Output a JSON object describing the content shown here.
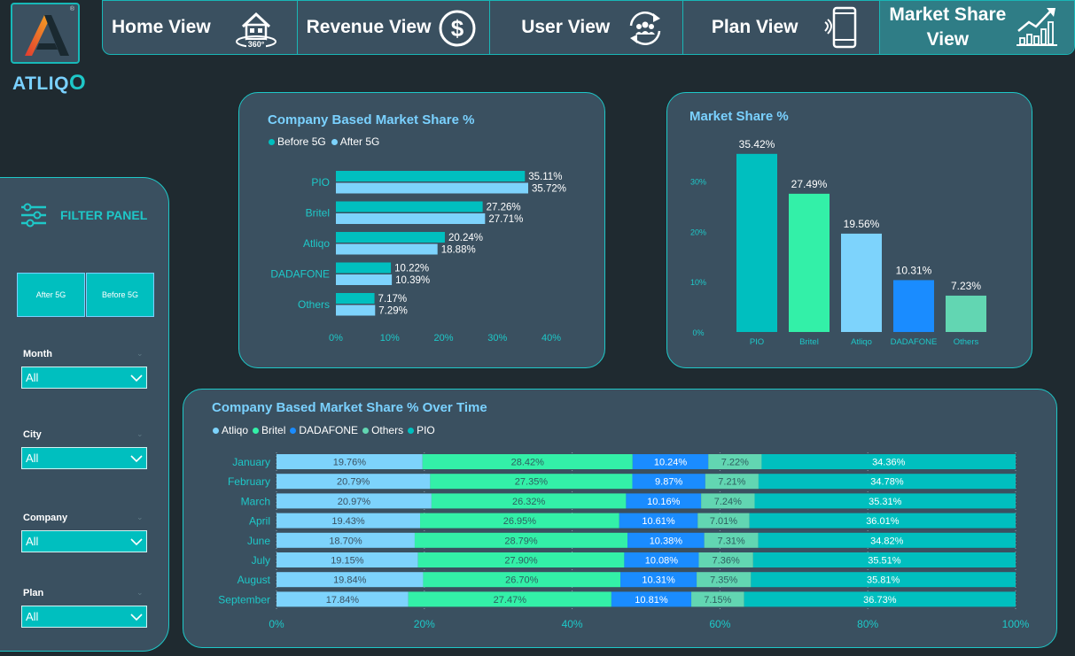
{
  "brand": {
    "name": "ATLIQ",
    "name_suffix": "O",
    "registered": "®"
  },
  "nav": [
    {
      "label": "Home View",
      "icon": "home-360-icon"
    },
    {
      "label": "Revenue View",
      "icon": "dollar-icon"
    },
    {
      "label": "User View",
      "icon": "users-icon"
    },
    {
      "label": "Plan View",
      "icon": "mobile-icon"
    },
    {
      "label_line1": "Market Share",
      "label_line2": "View",
      "icon": "growth-chart-icon",
      "active": true
    }
  ],
  "filter_panel": {
    "title": "FILTER PANEL",
    "buttons": [
      "After 5G",
      "Before 5G"
    ],
    "filters": [
      {
        "label": "Month",
        "value": "All"
      },
      {
        "label": "City",
        "value": "All"
      },
      {
        "label": "Company",
        "value": "All"
      },
      {
        "label": "Plan",
        "value": "All"
      }
    ]
  },
  "colors": {
    "accent": "#1ec8c8",
    "title": "#7ad1ff",
    "card_bg": "#3a5060",
    "page_bg": "#1f2a30",
    "atliqo": "#7dd3fc",
    "britel": "#33f0a8",
    "dadafone": "#1a8cff",
    "others": "#62d6b2",
    "pio": "#00bfbf"
  },
  "chart_data": [
    {
      "id": "company-market-share",
      "type": "bar",
      "orientation": "horizontal",
      "title": "Company Based Market Share %",
      "categories": [
        "PIO",
        "Britel",
        "Atliqo",
        "DADAFONE",
        "Others"
      ],
      "series": [
        {
          "name": "Before 5G",
          "values": [
            35.11,
            27.26,
            20.24,
            10.22,
            7.17
          ],
          "labels": [
            "35.11%",
            "27.26%",
            "20.24%",
            "10.22%",
            "7.17%"
          ],
          "color": "#00bfbf"
        },
        {
          "name": "After 5G",
          "values": [
            35.72,
            27.71,
            18.88,
            10.39,
            7.29
          ],
          "labels": [
            "35.72%",
            "27.71%",
            "18.88%",
            "10.39%",
            "7.29%"
          ],
          "color": "#7dd3fc"
        }
      ],
      "xlim": [
        0,
        40
      ],
      "xticks": [
        "0%",
        "10%",
        "20%",
        "30%",
        "40%"
      ]
    },
    {
      "id": "market-share",
      "type": "bar",
      "title": "Market Share %",
      "categories": [
        "PIO",
        "Britel",
        "Atliqo",
        "DADAFONE",
        "Others"
      ],
      "values": [
        35.42,
        27.49,
        19.56,
        10.31,
        7.23
      ],
      "labels": [
        "35.42%",
        "27.49%",
        "19.56%",
        "10.31%",
        "7.23%"
      ],
      "colors": [
        "#00bfbf",
        "#33f0a8",
        "#7dd3fc",
        "#1a8cff",
        "#62d6b2"
      ],
      "ylim": [
        0,
        36
      ],
      "yticks": [
        "0%",
        "10%",
        "20%",
        "30%"
      ]
    },
    {
      "id": "market-share-over-time",
      "type": "bar",
      "stacked": "percent",
      "orientation": "horizontal",
      "title": "Company Based Market Share % Over Time",
      "categories": [
        "January",
        "February",
        "March",
        "April",
        "June",
        "July",
        "August",
        "September"
      ],
      "series": [
        {
          "name": "Atliqo",
          "color": "#7dd3fc",
          "values": [
            19.76,
            20.79,
            20.97,
            19.43,
            18.7,
            19.15,
            19.84,
            17.84
          ],
          "labels": [
            "19.76%",
            "20.79%",
            "20.97%",
            "19.43%",
            "18.70%",
            "19.15%",
            "19.84%",
            "17.84%"
          ]
        },
        {
          "name": "Britel",
          "color": "#33f0a8",
          "values": [
            28.42,
            27.35,
            26.32,
            26.95,
            28.79,
            27.9,
            26.7,
            27.47
          ],
          "labels": [
            "28.42%",
            "27.35%",
            "26.32%",
            "26.95%",
            "28.79%",
            "27.90%",
            "26.70%",
            "27.47%"
          ]
        },
        {
          "name": "DADAFONE",
          "color": "#1a8cff",
          "values": [
            10.24,
            9.87,
            10.16,
            10.61,
            10.38,
            10.08,
            10.31,
            10.81
          ],
          "labels": [
            "10.24%",
            "9.87%",
            "10.16%",
            "10.61%",
            "10.38%",
            "10.08%",
            "10.31%",
            "10.81%"
          ]
        },
        {
          "name": "Others",
          "color": "#62d6b2",
          "values": [
            7.22,
            7.21,
            7.24,
            7.01,
            7.31,
            7.36,
            7.35,
            7.15
          ],
          "labels": [
            "7.22%",
            "7.21%",
            "7.24%",
            "7.01%",
            "7.31%",
            "7.36%",
            "7.35%",
            "7.15%"
          ]
        },
        {
          "name": "PIO",
          "color": "#00bfbf",
          "values": [
            34.36,
            34.78,
            35.31,
            36.01,
            34.82,
            35.51,
            35.81,
            36.73
          ],
          "labels": [
            "34.36%",
            "34.78%",
            "35.31%",
            "36.01%",
            "34.82%",
            "35.51%",
            "35.81%",
            "36.73%"
          ]
        }
      ],
      "xlim": [
        0,
        100
      ],
      "xticks": [
        "0%",
        "20%",
        "40%",
        "60%",
        "80%",
        "100%"
      ]
    }
  ]
}
